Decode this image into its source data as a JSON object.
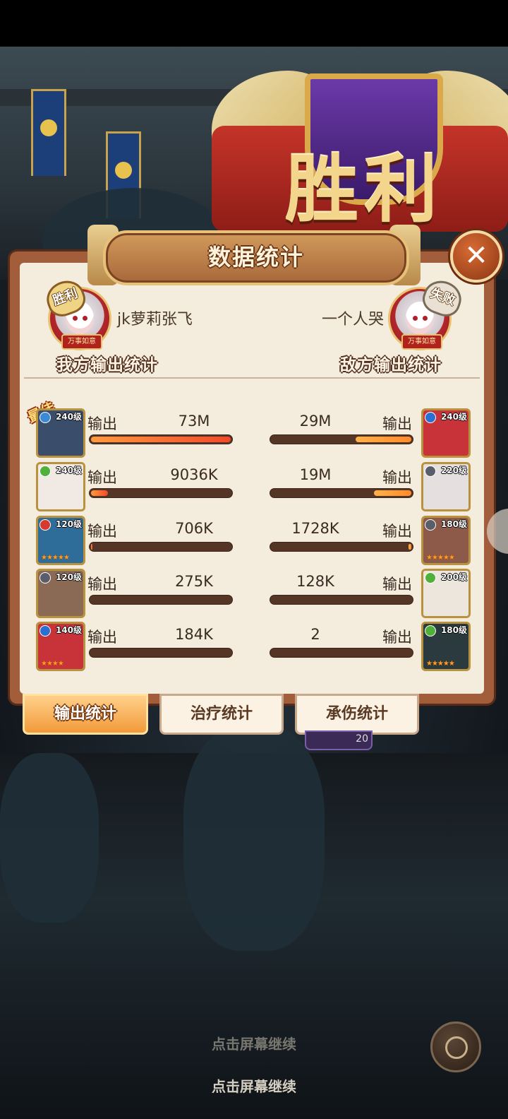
{
  "title": "数据统计",
  "victory_banner": "胜利",
  "close_label": "✕",
  "my_player": {
    "name": "jk萝莉张飞",
    "result": "胜利",
    "blessing": "万事如意",
    "stats_label": "我方输出统计"
  },
  "enemy_player": {
    "name": "一个人哭",
    "result": "失败",
    "blessing": "万事如意",
    "stats_label": "敌方输出统计"
  },
  "best_tag": "最佳",
  "stat_word": "输出",
  "rows": [
    {
      "left": {
        "level": "240级",
        "value": "73M",
        "fill": 1.0,
        "element_color": "#3a8ad8",
        "portrait_color": "#3a4d6a",
        "stars": ""
      },
      "right": {
        "level": "240级",
        "value": "29M",
        "fill": 0.4,
        "element_color": "#2b6fd0",
        "portrait_color": "#c8333a",
        "stars": ""
      }
    },
    {
      "left": {
        "level": "240级",
        "value": "9036K",
        "fill": 0.12,
        "element_color": "#4fb03a",
        "portrait_color": "#f0e9e4",
        "stars": ""
      },
      "right": {
        "level": "220级",
        "value": "19M",
        "fill": 0.27,
        "element_color": "#5a5e6a",
        "portrait_color": "#e6dfe0",
        "stars": ""
      }
    },
    {
      "left": {
        "level": "120级",
        "value": "706K",
        "fill": 0.01,
        "element_color": "#d63a2c",
        "portrait_color": "#2e6c9a",
        "stars": "★★★★★"
      },
      "right": {
        "level": "180级",
        "value": "1728K",
        "fill": 0.02,
        "element_color": "#5a5e6a",
        "portrait_color": "#8d5a4a",
        "stars": "★★★★★"
      }
    },
    {
      "left": {
        "level": "120级",
        "value": "275K",
        "fill": 0.0,
        "element_color": "#5a5e6a",
        "portrait_color": "#8a6a54",
        "stars": ""
      },
      "right": {
        "level": "200级",
        "value": "128K",
        "fill": 0.0,
        "element_color": "#4fb03a",
        "portrait_color": "#ece6dd",
        "stars": ""
      }
    },
    {
      "left": {
        "level": "140级",
        "value": "184K",
        "fill": 0.0,
        "element_color": "#2b6fd0",
        "portrait_color": "#c8333a",
        "stars": "★★★★"
      },
      "right": {
        "level": "180级",
        "value": "2",
        "fill": 0.0,
        "element_color": "#4fb03a",
        "portrait_color": "#2a3a3e",
        "stars": "★★★★★"
      }
    }
  ],
  "tabs": [
    {
      "label": "输出统计",
      "active": true
    },
    {
      "label": "治疗统计",
      "active": false
    },
    {
      "label": "承伤统计",
      "active": false
    }
  ],
  "under_badge_count": "20",
  "continue_text": "点击屏幕继续"
}
